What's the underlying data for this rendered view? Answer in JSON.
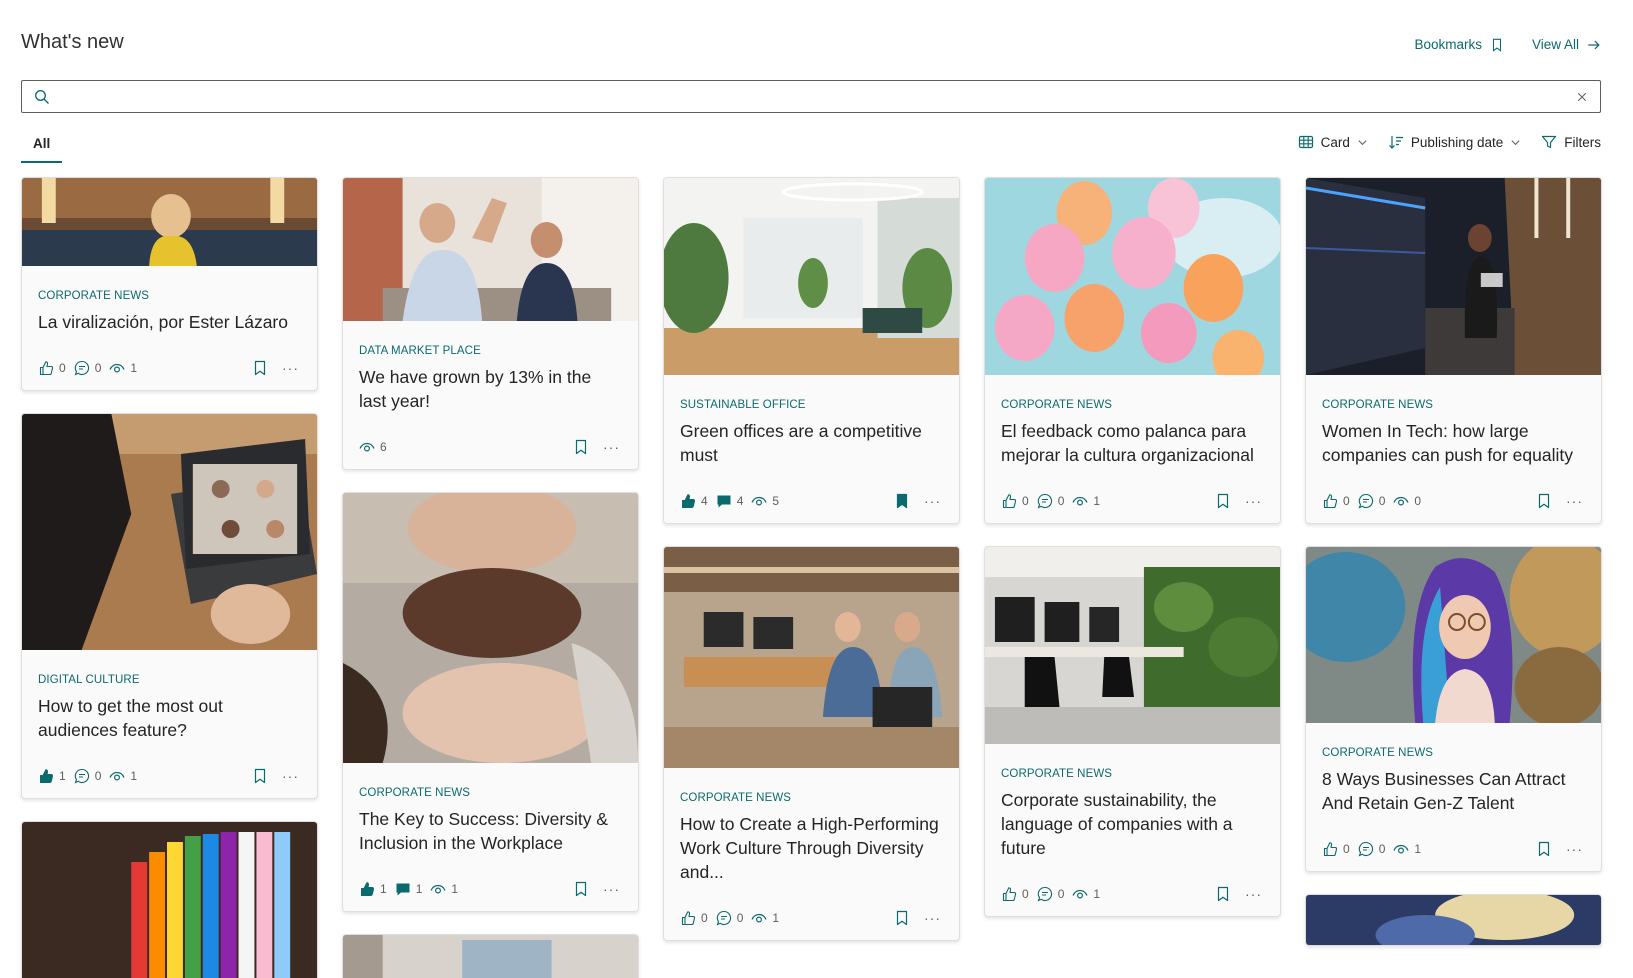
{
  "header": {
    "title": "What's new",
    "bookmarks_label": "Bookmarks",
    "view_all_label": "View All"
  },
  "search": {
    "value": "",
    "placeholder": ""
  },
  "tabs": [
    {
      "label": "All",
      "selected": true
    }
  ],
  "controls": {
    "view_label": "Card",
    "sort_label": "Publishing date",
    "filters_label": "Filters"
  },
  "colors": {
    "accent": "#0b6a6e",
    "title_text": "#252423",
    "muted_text": "#605e5c"
  },
  "columns": [
    [
      {
        "category": "CORPORATE NEWS",
        "title": "La viralización, por Ester Lázaro",
        "image": "woman-in-yellow-jacket-office-lounge",
        "likes": "0",
        "comments": "0",
        "views": "1",
        "liked": false,
        "commented": false,
        "bookmarked": false,
        "show_likes": true,
        "show_comments": true
      },
      {
        "category": "DIGITAL CULTURE",
        "title": "How to get the most out audiences feature?",
        "image": "person-on-video-call-laptop",
        "likes": "1",
        "comments": "0",
        "views": "1",
        "liked": true,
        "commented": false,
        "bookmarked": false,
        "show_likes": true,
        "show_comments": true
      },
      {
        "image": "rainbow-figurines"
      }
    ],
    [
      {
        "category": "DATA MARKET PLACE",
        "title": "We have grown by 13% in the last year!",
        "image": "colleagues-high-five",
        "likes": "",
        "comments": "",
        "views": "6",
        "liked": false,
        "commented": false,
        "bookmarked": false,
        "show_likes": false,
        "show_comments": false
      },
      {
        "category": "CORPORATE NEWS",
        "title": "The Key to Success: Diversity & Inclusion in the Workplace",
        "image": "three-faces-together",
        "likes": "1",
        "comments": "1",
        "views": "1",
        "liked": true,
        "commented": true,
        "bookmarked": false,
        "show_likes": true,
        "show_comments": true
      },
      {
        "image": "office-wall-partial"
      }
    ],
    [
      {
        "category": "SUSTAINABLE OFFICE",
        "title": "Green offices are a competitive must",
        "image": "bright-green-office",
        "likes": "4",
        "comments": "4",
        "views": "5",
        "liked": true,
        "commented": true,
        "bookmarked": true,
        "show_likes": true,
        "show_comments": true
      },
      {
        "category": "CORPORATE NEWS",
        "title": "How to Create a High-Performing Work Culture Through Diversity and...",
        "image": "open-office-team-working",
        "likes": "0",
        "comments": "0",
        "views": "1",
        "liked": false,
        "commented": false,
        "bookmarked": false,
        "show_likes": true,
        "show_comments": true
      }
    ],
    [
      {
        "category": "CORPORATE NEWS",
        "title": "El feedback como palanca para mejorar la cultura organizacional",
        "image": "smiley-balloons",
        "likes": "0",
        "comments": "0",
        "views": "1",
        "liked": false,
        "commented": false,
        "bookmarked": false,
        "show_likes": true,
        "show_comments": true
      },
      {
        "category": "CORPORATE NEWS",
        "title": "Corporate sustainability, the language of companies with a future",
        "image": "office-with-green-wall",
        "likes": "0",
        "comments": "0",
        "views": "1",
        "liked": false,
        "commented": false,
        "bookmarked": false,
        "show_likes": true,
        "show_comments": true
      }
    ],
    [
      {
        "category": "CORPORATE NEWS",
        "title": "Women In Tech: how large companies can push for equality",
        "image": "woman-in-server-room",
        "likes": "0",
        "comments": "0",
        "views": "0",
        "liked": false,
        "commented": false,
        "bookmarked": false,
        "show_likes": true,
        "show_comments": true
      },
      {
        "category": "CORPORATE NEWS",
        "title": "8 Ways Businesses Can Attract And Retain Gen-Z Talent",
        "image": "woman-with-colorful-braids",
        "likes": "0",
        "comments": "0",
        "views": "1",
        "liked": false,
        "commented": false,
        "bookmarked": false,
        "show_likes": true,
        "show_comments": true
      },
      {
        "image": "blurred-photo-partial"
      }
    ]
  ]
}
